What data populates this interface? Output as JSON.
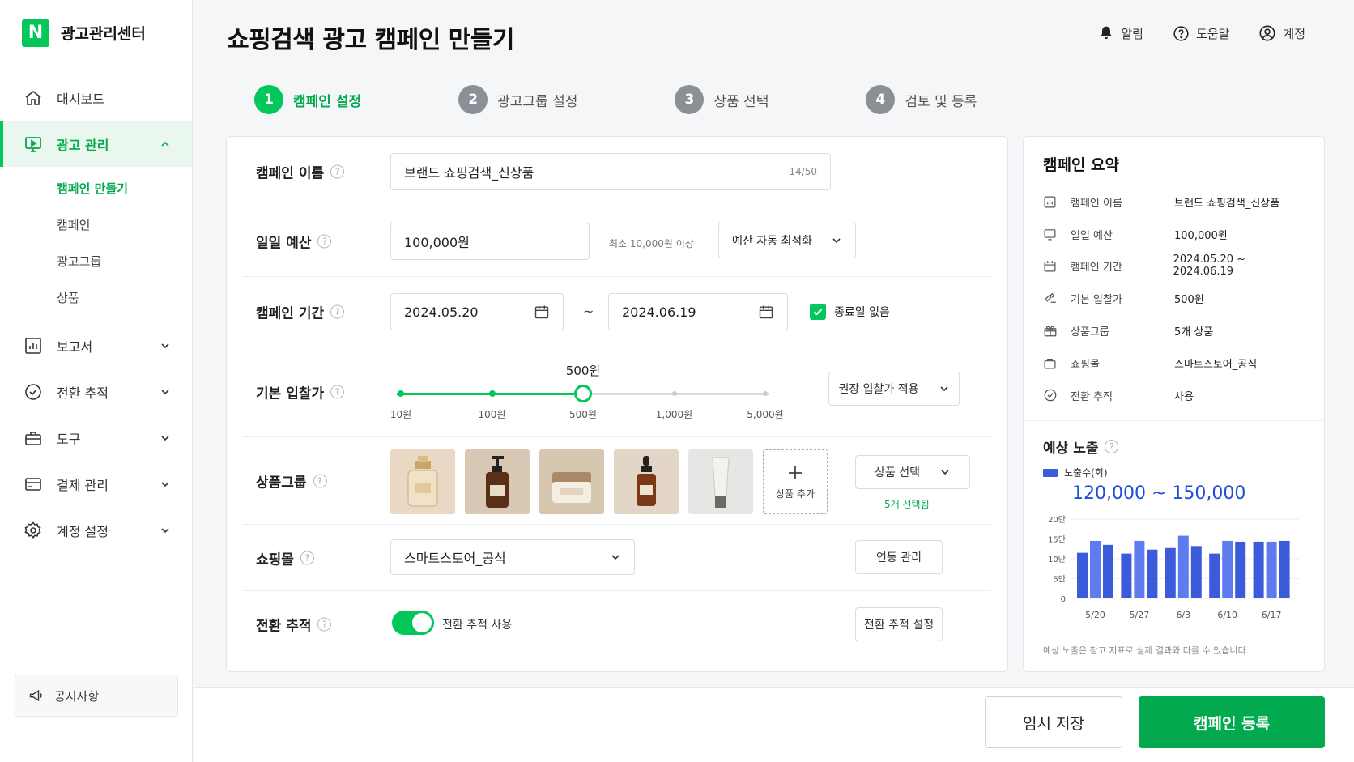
{
  "brand": {
    "logo": "N",
    "title": "광고관리센터"
  },
  "sidebar": {
    "items": [
      {
        "label": "대시보드",
        "icon": "home-icon"
      },
      {
        "label": "광고 관리",
        "icon": "ad-icon",
        "active": true
      },
      {
        "label": "보고서",
        "icon": "report-icon"
      },
      {
        "label": "전환 추적",
        "icon": "check-circle-icon"
      },
      {
        "label": "도구",
        "icon": "briefcase-icon"
      },
      {
        "label": "결제 관리",
        "icon": "card-icon"
      },
      {
        "label": "계정 설정",
        "icon": "gear-icon"
      }
    ],
    "sub_items": [
      {
        "label": "캠페인 만들기",
        "active": true
      },
      {
        "label": "캠페인"
      },
      {
        "label": "광고그룹"
      },
      {
        "label": "상품"
      }
    ],
    "notice": "공지사항"
  },
  "header": {
    "title": "쇼핑검색 광고 캠페인 만들기",
    "actions": [
      {
        "label": "알림",
        "icon": "bell-icon"
      },
      {
        "label": "도움말",
        "icon": "help-icon"
      },
      {
        "label": "계정",
        "icon": "user-icon"
      }
    ]
  },
  "stepper": [
    {
      "num": "1",
      "label": "캠페인 설정",
      "active": true
    },
    {
      "num": "2",
      "label": "광고그룹 설정"
    },
    {
      "num": "3",
      "label": "상품 선택"
    },
    {
      "num": "4",
      "label": "검토 및 등록"
    }
  ],
  "form": {
    "name": {
      "label": "캠페인 이름",
      "value": "브랜드 쇼핑검색_신상품",
      "count": "14/50"
    },
    "budget": {
      "label": "일일 예산",
      "value": "100,000원",
      "hint": "최소 10,000원 이상",
      "option": "예산 자동 최적화"
    },
    "period": {
      "label": "캠페인 기간",
      "start": "2024.05.20",
      "sep": "~",
      "end": "2024.06.19",
      "no_end": "종료일 없음"
    },
    "bid": {
      "label": "기본 입찰가",
      "value": "500원",
      "ticks": [
        "10원",
        "100원",
        "500원",
        "1,000원",
        "5,000원"
      ],
      "selected_index": 2,
      "button": "권장 입찰가 적용"
    },
    "products": {
      "label": "상품그룹",
      "add": "상품 추가",
      "button": "상품 선택",
      "selected": "5개 선택됨"
    },
    "mall": {
      "label": "쇼핑몰",
      "value": "스마트스토어_공식",
      "button": "연동 관리"
    },
    "conversion": {
      "label": "전환 추적",
      "toggle_label": "전환 추적 사용",
      "enabled": true,
      "button": "전환 추적 설정"
    }
  },
  "summary": {
    "title": "캠페인 요약",
    "rows": [
      {
        "k": "캠페인 이름",
        "v": "브랜드 쇼핑검색_신상품",
        "icon": "chart-box-icon"
      },
      {
        "k": "일일 예산",
        "v": "100,000원",
        "icon": "monitor-icon"
      },
      {
        "k": "캠페인 기간",
        "v": "2024.05.20 ~ 2024.06.19",
        "icon": "calendar-icon"
      },
      {
        "k": "기본 입찰가",
        "v": "500원",
        "icon": "bid-icon"
      },
      {
        "k": "상품그룹",
        "v": "5개 상품",
        "icon": "gift-icon"
      },
      {
        "k": "쇼핑몰",
        "v": "스마트스토어_공식",
        "icon": "bag-icon"
      },
      {
        "k": "전환 추적",
        "v": "사용",
        "icon": "check-circle-icon"
      }
    ],
    "expected_title": "예상 노출",
    "legend": "노출수(회)",
    "range": "120,000 ~ 150,000",
    "disclaimer": "예상 노출은 참고 지표로 실제 결과와 다를 수 있습니다."
  },
  "chart_data": {
    "type": "bar",
    "series": [
      {
        "name": "노출수(회)",
        "values": [
          11.5,
          14.5,
          13.5,
          11.3,
          14.5,
          12.3,
          12.7,
          15.8,
          13.2,
          11.3,
          14.5,
          14.3,
          14.3,
          14.3,
          14.5
        ]
      }
    ],
    "x_labels": [
      "5/20",
      "5/27",
      "6/3",
      "6/10",
      "6/17"
    ],
    "y_ticks": [
      "0",
      "5만",
      "10만",
      "15만",
      "20만"
    ],
    "ylim": [
      0,
      20
    ],
    "color": "#3b5bdb"
  },
  "footer": {
    "draft": "임시 저장",
    "submit": "캠페인 등록"
  },
  "colors": {
    "accent": "#03c75a",
    "accent_dark": "#03a94e",
    "chart": "#3b5bdb"
  }
}
